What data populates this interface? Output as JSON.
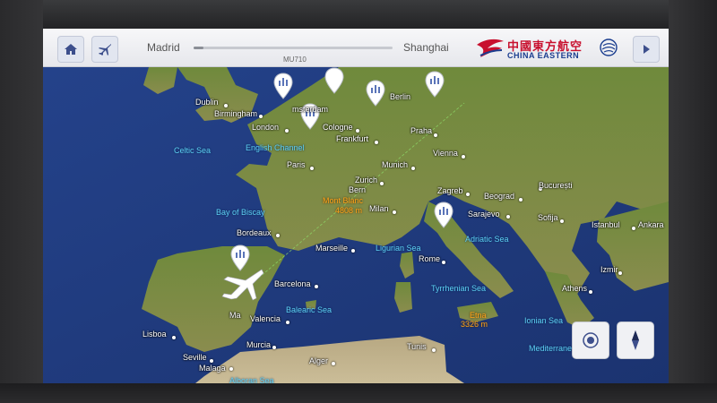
{
  "header": {
    "route_from": "Madrid",
    "route_to": "Shanghai",
    "flight_number": "MU710",
    "progress_fraction": 0.05,
    "airline_name_cn": "中國東方航空",
    "airline_name_en": "CHINA EASTERN"
  },
  "buttons": {
    "home_icon": "home-icon",
    "flight_icon": "airplane-icon",
    "next_icon": "play-icon",
    "center_icon": "target-icon",
    "compass_icon": "compass-icon"
  },
  "cities": {
    "dublin": "Dublin",
    "birmingham": "Birmingham",
    "amsterdam": "msterdam",
    "berlin": "Berlin",
    "london": "London",
    "cologne": "Cologne",
    "frankfurt": "Frankfurt",
    "praha": "Praha",
    "paris": "Paris",
    "munich": "Munich",
    "vienna": "Vienna",
    "zurich": "Zurich",
    "bern": "Bern",
    "zagreb": "Zagreb",
    "bucuresti": "București",
    "beograd": "Beograd",
    "milan": "Milan",
    "bordeaux": "Bordeaux",
    "sarajevo": "Sarajevo",
    "sofija": "Sofija",
    "istanbul": "Istanbul",
    "ankara": "Ankara",
    "marseille": "Marseille",
    "rome": "Rome",
    "izmir": "Izmir",
    "barcelona": "Barcelona",
    "athens": "Athens",
    "madrid": "Ma",
    "valencia": "Valencia",
    "lisboa": "Lisboa",
    "murcia": "Murcia",
    "tunis": "Tunis",
    "seville": "Seville",
    "malaga": "Malaga",
    "alger": "Alger"
  },
  "seas": {
    "celtic": "Celtic Sea",
    "english_channel": "English Channel",
    "biscay": "Bay of Biscay",
    "ligurian": "Ligurian Sea",
    "adriatic": "Adriatic Sea",
    "tyrrhenian": "Tyrrhenian Sea",
    "balearic": "Balearic Sea",
    "ionian": "Ionian Sea",
    "mediterranean": "Mediterranean Sea",
    "alboran": "Alboran Sea"
  },
  "peaks": {
    "mont_blanc": "Mont Blanc",
    "mont_blanc_height": "4808 m",
    "etna": "Etna",
    "etna_height": "3326 m"
  },
  "colors": {
    "sea": "#1f3a7a",
    "land": "#6f8a3c",
    "airline_red": "#c8102e",
    "airline_blue": "#1a3d8f",
    "sea_label": "#5fd0f2",
    "peak_label": "#ffa31a"
  }
}
